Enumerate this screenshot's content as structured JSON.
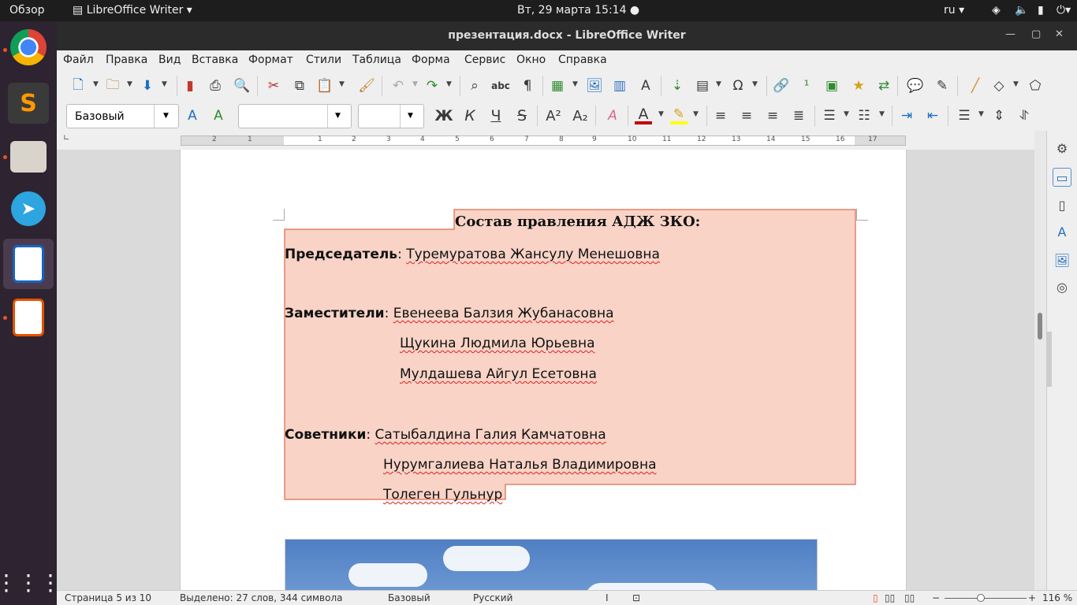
{
  "system": {
    "activities": "Обзор",
    "app_menu": "LibreOffice Writer",
    "datetime": "Вт, 29 марта  15:14",
    "lang": "ru"
  },
  "window": {
    "title": "презентация.docx - LibreOffice Writer"
  },
  "menu": [
    "Файл",
    "Правка",
    "Вид",
    "Вставка",
    "Формат",
    "Стили",
    "Таблица",
    "Форма",
    "Сервис",
    "Окно",
    "Справка"
  ],
  "format": {
    "paragraph_style": "Базовый",
    "font_name": "",
    "font_size": ""
  },
  "ruler": {
    "ticks": [
      "2",
      "1",
      "1",
      "2",
      "3",
      "4",
      "5",
      "6",
      "7",
      "8",
      "9",
      "10",
      "11",
      "12",
      "13",
      "14",
      "15",
      "16",
      "17"
    ]
  },
  "document": {
    "heading": "Состав правления АДЖ ЗКО:",
    "chair_label": "Председатель",
    "chair_rest": ": ",
    "chair_name": "Туремуратова Жансулу Менешовна",
    "deputies_label": "Заместители",
    "deputies_rest": ": ",
    "deputy1": "Евенеева Балзия Жубанасовна",
    "deputy2": "Щукина Людмила Юрьевна",
    "deputy3": "Мулдашева Айгул Есетовна",
    "advisors_label": "Советники",
    "advisors_rest": ": ",
    "advisor1": "Сатыбалдина Галия Камчатовна",
    "advisor2": "Нурумгалиева Наталья Владимировна",
    "advisor3": "Толеген Гульнур"
  },
  "status": {
    "page": "Страница 5 из 10",
    "selection": "Выделено: 27 слов, 344 символа",
    "style": "Базовый",
    "language": "Русский",
    "zoom": "116 %"
  },
  "colors": {
    "highlight": "#f8d3c6",
    "highlight_border": "#d94f2a",
    "accent": "#e95420"
  }
}
